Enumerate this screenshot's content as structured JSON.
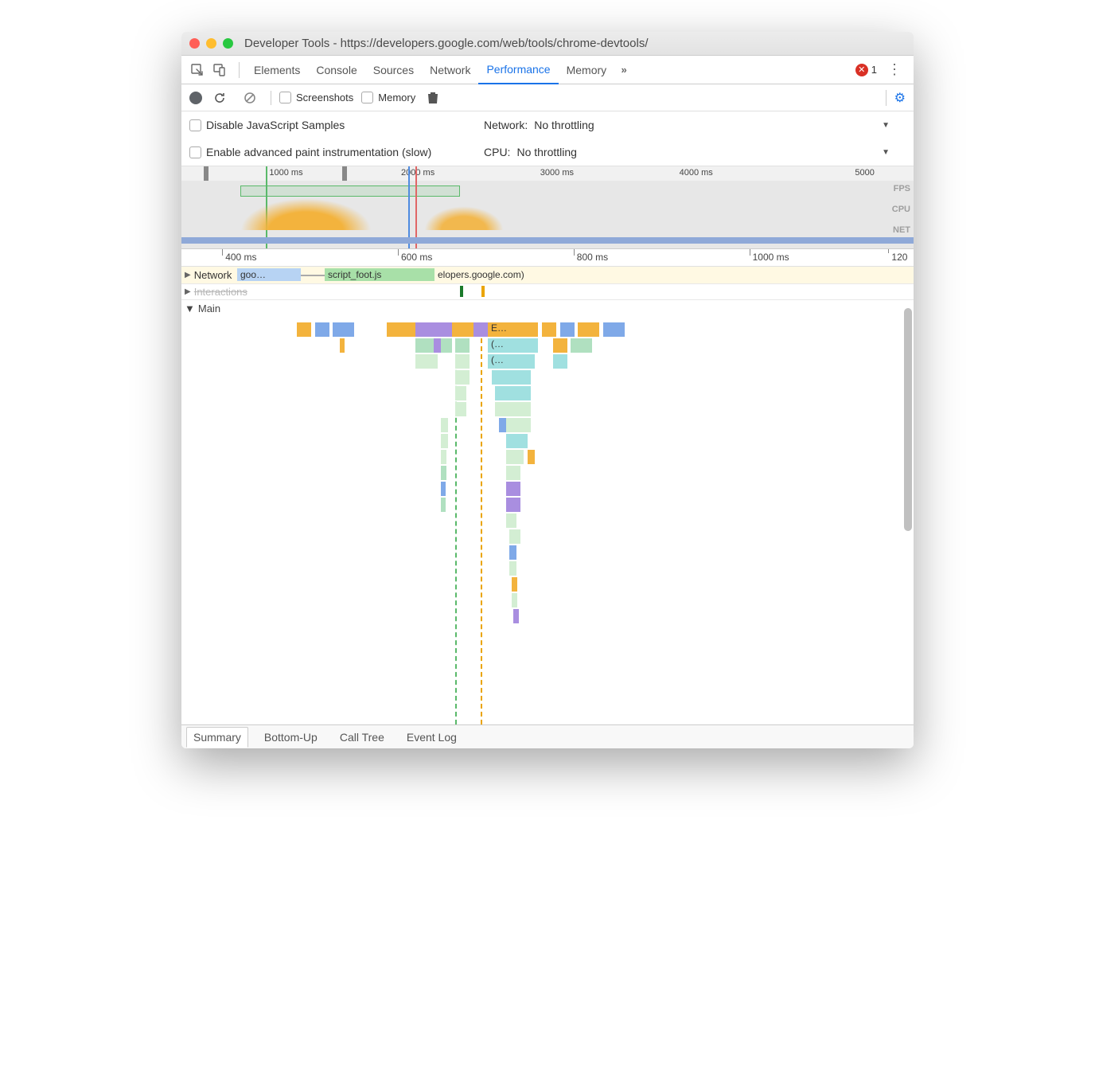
{
  "window": {
    "title": "Developer Tools - https://developers.google.com/web/tools/chrome-devtools/"
  },
  "tabs": {
    "items": [
      "Elements",
      "Console",
      "Sources",
      "Network",
      "Performance",
      "Memory"
    ],
    "active": "Performance",
    "overflow_icon": ">>",
    "error_count": "1"
  },
  "toolbar": {
    "screenshots_label": "Screenshots",
    "memory_label": "Memory"
  },
  "settings": {
    "disable_js_label": "Disable JavaScript Samples",
    "enable_paint_label": "Enable advanced paint instrumentation (slow)",
    "network_label": "Network:",
    "network_value": "No throttling",
    "cpu_label": "CPU:",
    "cpu_value": "No throttling"
  },
  "overview": {
    "ticks": [
      "1000 ms",
      "2000 ms",
      "3000 ms",
      "4000 ms",
      "5000"
    ],
    "lane_labels": [
      "FPS",
      "CPU",
      "NET"
    ]
  },
  "zoom_ruler": {
    "ticks": [
      "400 ms",
      "600 ms",
      "800 ms",
      "1000 ms",
      "120"
    ]
  },
  "tracks": {
    "network_label": "Network",
    "network_items": [
      "goo…",
      "script_foot.js",
      "elopers.google.com)"
    ],
    "interactions_label": "Interactions",
    "main_label": "Main",
    "flame_text": [
      "E…",
      "(…",
      "(…"
    ]
  },
  "bottom_tabs": {
    "items": [
      "Summary",
      "Bottom-Up",
      "Call Tree",
      "Event Log"
    ],
    "active": "Summary"
  }
}
